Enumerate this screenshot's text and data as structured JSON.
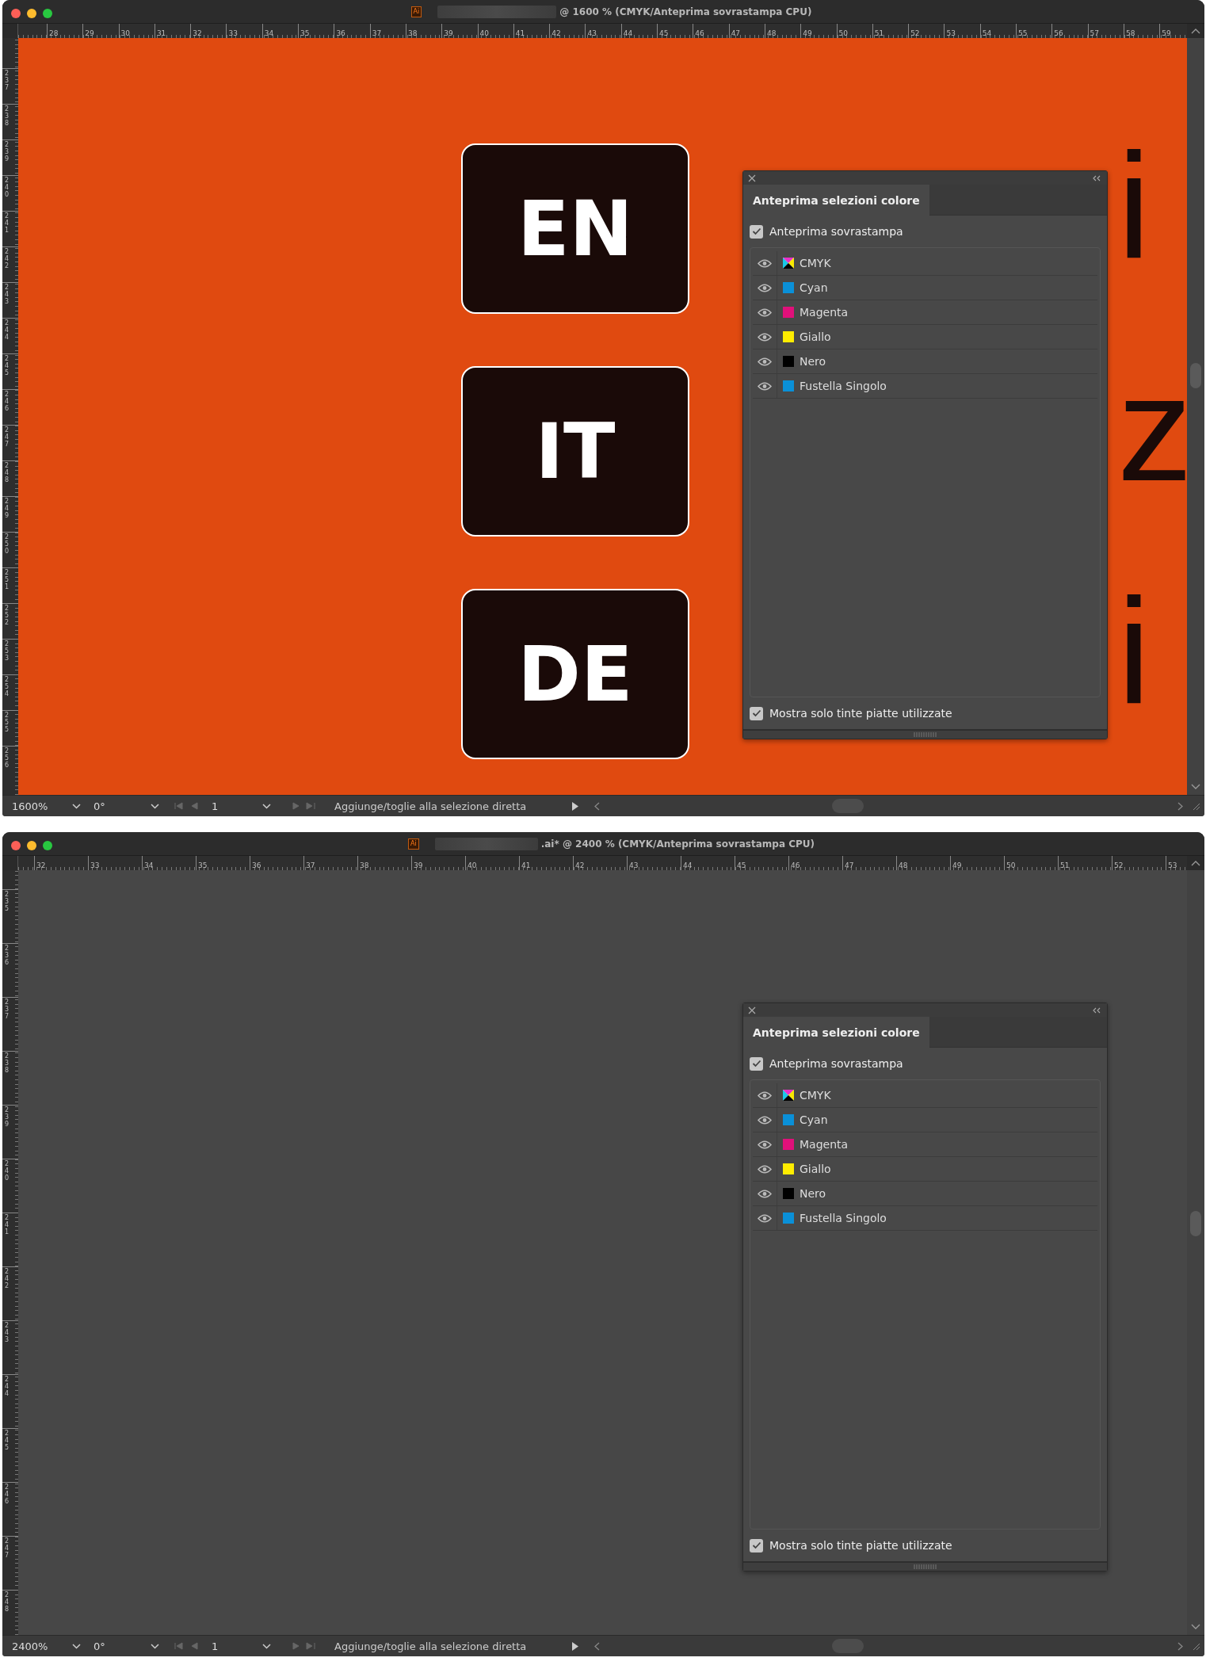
{
  "windows": [
    {
      "app_icon": "Ai",
      "title": "@ 1600 % (CMYK/Anteprima sovrastampa CPU)",
      "h_ruler": [
        "28",
        "29",
        "30",
        "31",
        "32",
        "33",
        "34",
        "35",
        "36",
        "37",
        "38",
        "39",
        "40",
        "41",
        "42",
        "43",
        "44",
        "45",
        "46",
        "47",
        "48",
        "49",
        "50",
        "51",
        "52",
        "53",
        "54",
        "55",
        "56",
        "57",
        "58",
        "59"
      ],
      "v_ruler": [
        "237",
        "238",
        "239",
        "240",
        "241",
        "242",
        "243",
        "244",
        "245",
        "246",
        "247",
        "248",
        "249",
        "250",
        "251",
        "252",
        "253",
        "254",
        "255",
        "256"
      ],
      "canvas": {
        "kind": "artwork",
        "tiles": [
          "EN",
          "IT",
          "DE"
        ],
        "background_text": [
          "i",
          "z",
          "i"
        ]
      },
      "panel": {
        "tab": "Anteprima selezioni colore",
        "overprint": {
          "label": "Anteprima sovrastampa",
          "checked": true
        },
        "separations": [
          {
            "name": "CMYK",
            "kind": "composite",
            "visible": true
          },
          {
            "name": "Cyan",
            "kind": "ink",
            "color": "#0a90d8",
            "visible": true
          },
          {
            "name": "Magenta",
            "kind": "ink",
            "color": "#e0107a",
            "visible": true
          },
          {
            "name": "Giallo",
            "kind": "ink",
            "color": "#ffec00",
            "visible": true
          },
          {
            "name": "Nero",
            "kind": "ink",
            "color": "#000000",
            "visible": true
          },
          {
            "name": "Fustella Singolo",
            "kind": "ink",
            "color": "#0a90d8",
            "visible": true
          }
        ],
        "spot_only": {
          "label": "Mostra solo tinte piatte utilizzate",
          "checked": true
        }
      },
      "status_bar": {
        "zoom": "1600%",
        "rotation": "0°",
        "artboard": "1",
        "tool_hint": "Aggiunge/toglie alla selezione diretta"
      }
    },
    {
      "app_icon": "Ai",
      "title": ".ai* @ 2400 % (CMYK/Anteprima sovrastampa CPU)",
      "h_ruler": [
        "32",
        "33",
        "34",
        "35",
        "36",
        "37",
        "38",
        "39",
        "40",
        "41",
        "42",
        "43",
        "44",
        "45",
        "46",
        "47",
        "48",
        "49",
        "50",
        "51",
        "52",
        "53"
      ],
      "v_ruler": [
        "235",
        "236",
        "237",
        "238",
        "239",
        "240",
        "241",
        "242",
        "243",
        "244",
        "245",
        "246",
        "247",
        "248"
      ],
      "canvas": {
        "kind": "empty"
      },
      "panel": {
        "tab": "Anteprima selezioni colore",
        "overprint": {
          "label": "Anteprima sovrastampa",
          "checked": true
        },
        "separations": [
          {
            "name": "CMYK",
            "kind": "composite",
            "visible": true
          },
          {
            "name": "Cyan",
            "kind": "ink",
            "color": "#0a90d8",
            "visible": true
          },
          {
            "name": "Magenta",
            "kind": "ink",
            "color": "#e0107a",
            "visible": true
          },
          {
            "name": "Giallo",
            "kind": "ink",
            "color": "#ffec00",
            "visible": true
          },
          {
            "name": "Nero",
            "kind": "ink",
            "color": "#000000",
            "visible": true
          },
          {
            "name": "Fustella Singolo",
            "kind": "ink",
            "color": "#0a90d8",
            "visible": true
          }
        ],
        "spot_only": {
          "label": "Mostra solo tinte piatte utilizzate",
          "checked": true
        }
      },
      "status_bar": {
        "zoom": "2400%",
        "rotation": "0°",
        "artboard": "1",
        "tool_hint": "Aggiunge/toglie alla selezione diretta"
      }
    }
  ]
}
